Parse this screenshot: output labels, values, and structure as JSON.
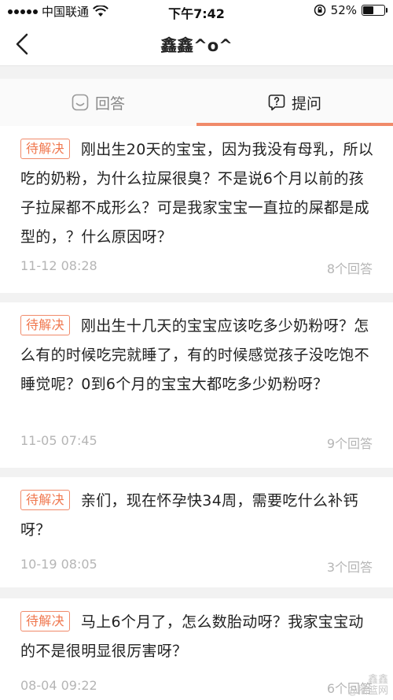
{
  "status_bar": {
    "carrier": "中国联通",
    "time": "下午7:42",
    "battery_percent": "52%",
    "battery_level": 0.52
  },
  "nav": {
    "title": "鑫鑫^o^"
  },
  "tabs": [
    {
      "label": "回答",
      "icon": "smiley-icon",
      "active": false
    },
    {
      "label": "提问",
      "icon": "question-bubble-icon",
      "active": true
    }
  ],
  "colors": {
    "accent": "#f08a6a",
    "badge_text": "#f0784f",
    "meta_text": "#b5b5b5",
    "background": "#f2f2f2"
  },
  "questions": [
    {
      "status": "待解决",
      "text": "刚出生20天的宝宝，因为我没有母乳，所以吃的奶粉，为什么拉屎很臭？不是说6个月以前的孩子拉屎都不成形么？可是我家宝宝一直拉的屎都是成型的，？什么原因呀？",
      "date": "11-12 08:28",
      "answers": "8个回答"
    },
    {
      "status": "待解决",
      "text": "刚出生十几天的宝宝应该吃多少奶粉呀？怎么有的时候吃完就睡了，有的时候感觉孩子没吃饱不睡觉呢？0到6个月的宝宝大都吃多少奶粉呀？",
      "date": "11-05 07:45",
      "answers": "9个回答"
    },
    {
      "status": "待解决",
      "text": "亲们，现在怀孕快34周，需要吃什么补钙呀？",
      "date": "10-19 08:05",
      "answers": "3个回答"
    },
    {
      "status": "待解决",
      "text": "马上6个月了，怎么数胎动呀？我家宝宝动的不是很明显很厉害呀？",
      "date": "08-04 09:22",
      "answers": "6个回答"
    }
  ],
  "watermark": {
    "line1": "鑫鑫",
    "line2": "@摇篮网"
  }
}
